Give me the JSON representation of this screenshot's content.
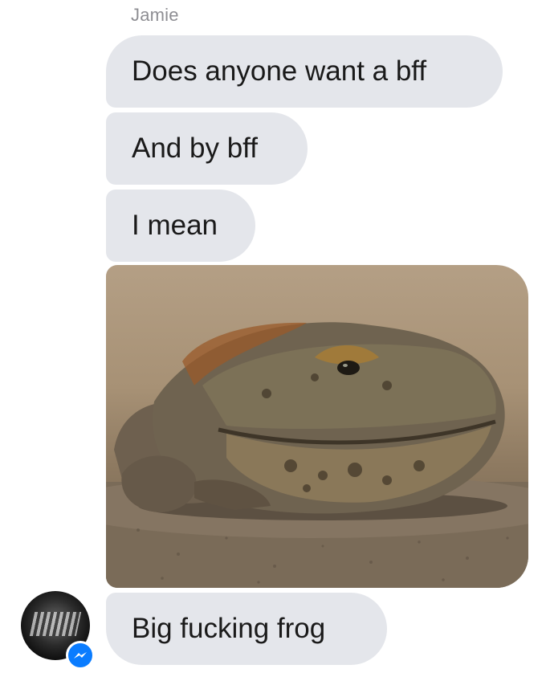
{
  "conversation": {
    "sender_name": "Jamie",
    "messages": [
      {
        "text": "Does anyone want a bff"
      },
      {
        "text": "And by bff"
      },
      {
        "text": "I mean"
      },
      {
        "type": "image",
        "subject": "frog"
      },
      {
        "text": "Big fucking frog"
      }
    ]
  },
  "colors": {
    "incoming_bubble": "#e4e6eb",
    "messenger_blue": "#0a7cff"
  },
  "icons": {
    "avatar": "profile-avatar",
    "badge": "messenger-icon"
  }
}
